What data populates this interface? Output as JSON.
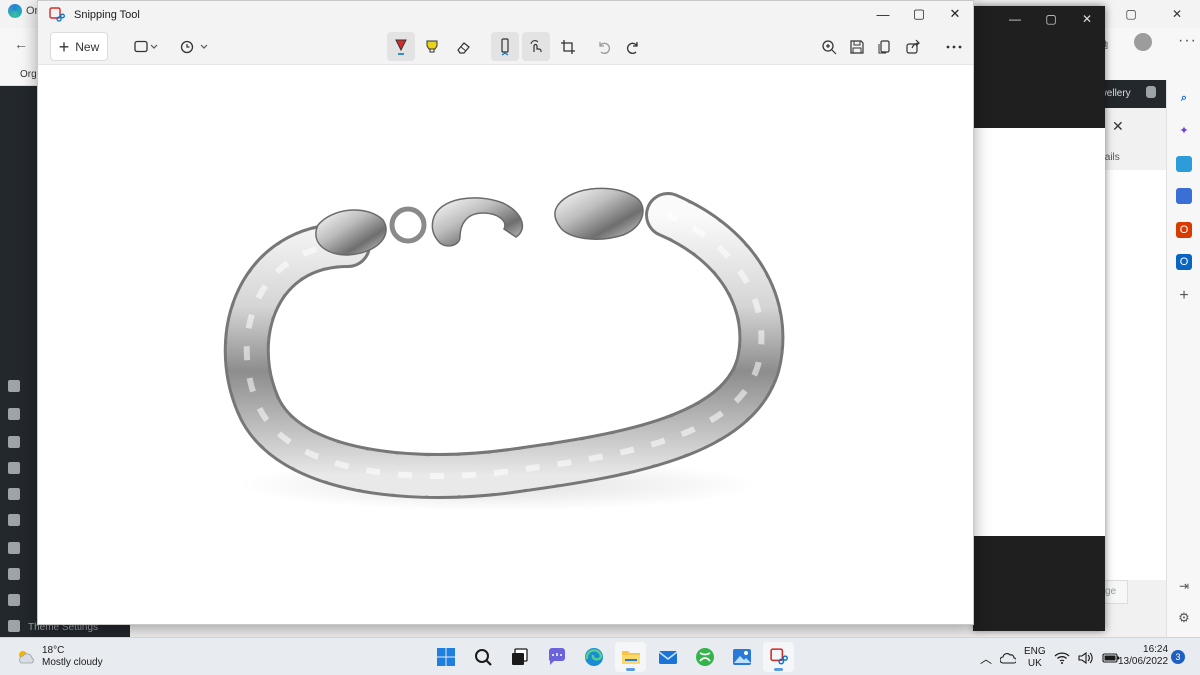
{
  "edge": {
    "tab_label": "Or",
    "favorites_label": "Orga",
    "wp_welcome": "ewellery",
    "wp_details": "tails",
    "wp_page_button": "ge",
    "wp_theme_settings": "Theme Settings",
    "window_controls": [
      "—",
      "▢",
      "✕"
    ]
  },
  "snipping_tool": {
    "title": "Snipping Tool",
    "toolbar": {
      "new_label": "New"
    },
    "window_controls": [
      "—",
      "▢",
      "✕"
    ]
  },
  "taskbar": {
    "weather": {
      "temp": "18°C",
      "condition": "Mostly cloudy"
    },
    "language": {
      "line1": "ENG",
      "line2": "UK"
    },
    "clock": {
      "time": "16:24",
      "date": "13/06/2022"
    },
    "notification_count": "3"
  },
  "colors": {
    "accent_blue": "#0078d4",
    "pen_red": "#d62a2a",
    "highlighter_yellow": "#e8d21a",
    "taskbar_bg": "#e8ebf0"
  }
}
